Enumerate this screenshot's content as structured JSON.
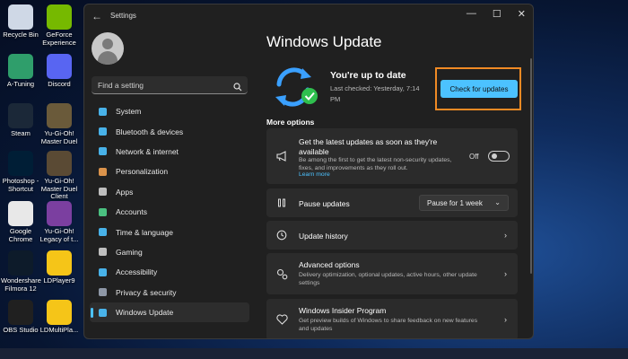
{
  "desktop": {
    "icons": [
      {
        "label": "Recycle Bin",
        "icon": "recycle-bin-icon",
        "color": "#cfd8e6"
      },
      {
        "label": "GeForce Experience",
        "icon": "geforce-icon",
        "color": "#76b900"
      },
      {
        "label": "A-Tuning",
        "icon": "a-tuning-icon",
        "color": "#2f9e6b"
      },
      {
        "label": "Discord",
        "icon": "discord-icon",
        "color": "#5865f2"
      },
      {
        "label": "Steam",
        "icon": "steam-icon",
        "color": "#1b2838"
      },
      {
        "label": "Yu-Gi-Oh! Master Duel",
        "icon": "yugioh-icon",
        "color": "#6a5a3a"
      },
      {
        "label": "Photoshop - Shortcut",
        "icon": "photoshop-icon",
        "color": "#001e36"
      },
      {
        "label": "Yu-Gi-Oh! Master Duel Client",
        "icon": "yugioh-client-icon",
        "color": "#5a4a34"
      },
      {
        "label": "Google Chrome",
        "icon": "chrome-icon",
        "color": "#e8e8e8"
      },
      {
        "label": "Yu-Gi-Oh! Legacy of t...",
        "icon": "yugioh-legacy-icon",
        "color": "#7b3fa0"
      },
      {
        "label": "Wondershare Filmora 12",
        "icon": "filmora-icon",
        "color": "#0d1b2a"
      },
      {
        "label": "LDPlayer9",
        "icon": "ldplayer-icon",
        "color": "#f5c518"
      },
      {
        "label": "OBS Studio",
        "icon": "obs-icon",
        "color": "#202020"
      },
      {
        "label": "LDMultiPla...",
        "icon": "ldmultiplayer-icon",
        "color": "#f5c518"
      }
    ]
  },
  "window": {
    "title": "Settings",
    "controls": {
      "minimize": "—",
      "maximize": "☐",
      "close": "✕"
    }
  },
  "sidebar": {
    "search_placeholder": "Find a setting",
    "items": [
      {
        "label": "System",
        "icon": "monitor-icon",
        "active": false
      },
      {
        "label": "Bluetooth & devices",
        "icon": "bluetooth-icon",
        "active": false
      },
      {
        "label": "Network & internet",
        "icon": "wifi-icon",
        "active": false
      },
      {
        "label": "Personalization",
        "icon": "brush-icon",
        "active": false
      },
      {
        "label": "Apps",
        "icon": "apps-icon",
        "active": false
      },
      {
        "label": "Accounts",
        "icon": "person-icon",
        "active": false
      },
      {
        "label": "Time & language",
        "icon": "globe-clock-icon",
        "active": false
      },
      {
        "label": "Gaming",
        "icon": "gamepad-icon",
        "active": false
      },
      {
        "label": "Accessibility",
        "icon": "accessibility-icon",
        "active": false
      },
      {
        "label": "Privacy & security",
        "icon": "shield-icon",
        "active": false
      },
      {
        "label": "Windows Update",
        "icon": "windows-update-icon",
        "active": true
      }
    ]
  },
  "main": {
    "page_title": "Windows Update",
    "status_title": "You're up to date",
    "status_sub": "Last checked: Yesterday, 7:14 PM",
    "check_button": "Check for updates",
    "more_options_label": "More options",
    "latest_updates": {
      "title": "Get the latest updates as soon as they're available",
      "desc": "Be among the first to get the latest non-security updates, fixes, and improvements as they roll out.",
      "learn_more": "Learn more",
      "toggle_label": "Off",
      "toggle_on": false
    },
    "pause_updates": {
      "title": "Pause updates",
      "selected": "Pause for 1 week"
    },
    "update_history": {
      "title": "Update history"
    },
    "advanced_options": {
      "title": "Advanced options",
      "desc": "Delivery optimization, optional updates, active hours, other update settings"
    },
    "insider": {
      "title": "Windows Insider Program",
      "desc": "Get preview builds of Windows to share feedback on new features and updates"
    }
  },
  "colors": {
    "accent": "#4cc2ff",
    "highlight": "#f08a24",
    "success": "#2fbf4e",
    "sync_blue": "#3aa0ff"
  }
}
